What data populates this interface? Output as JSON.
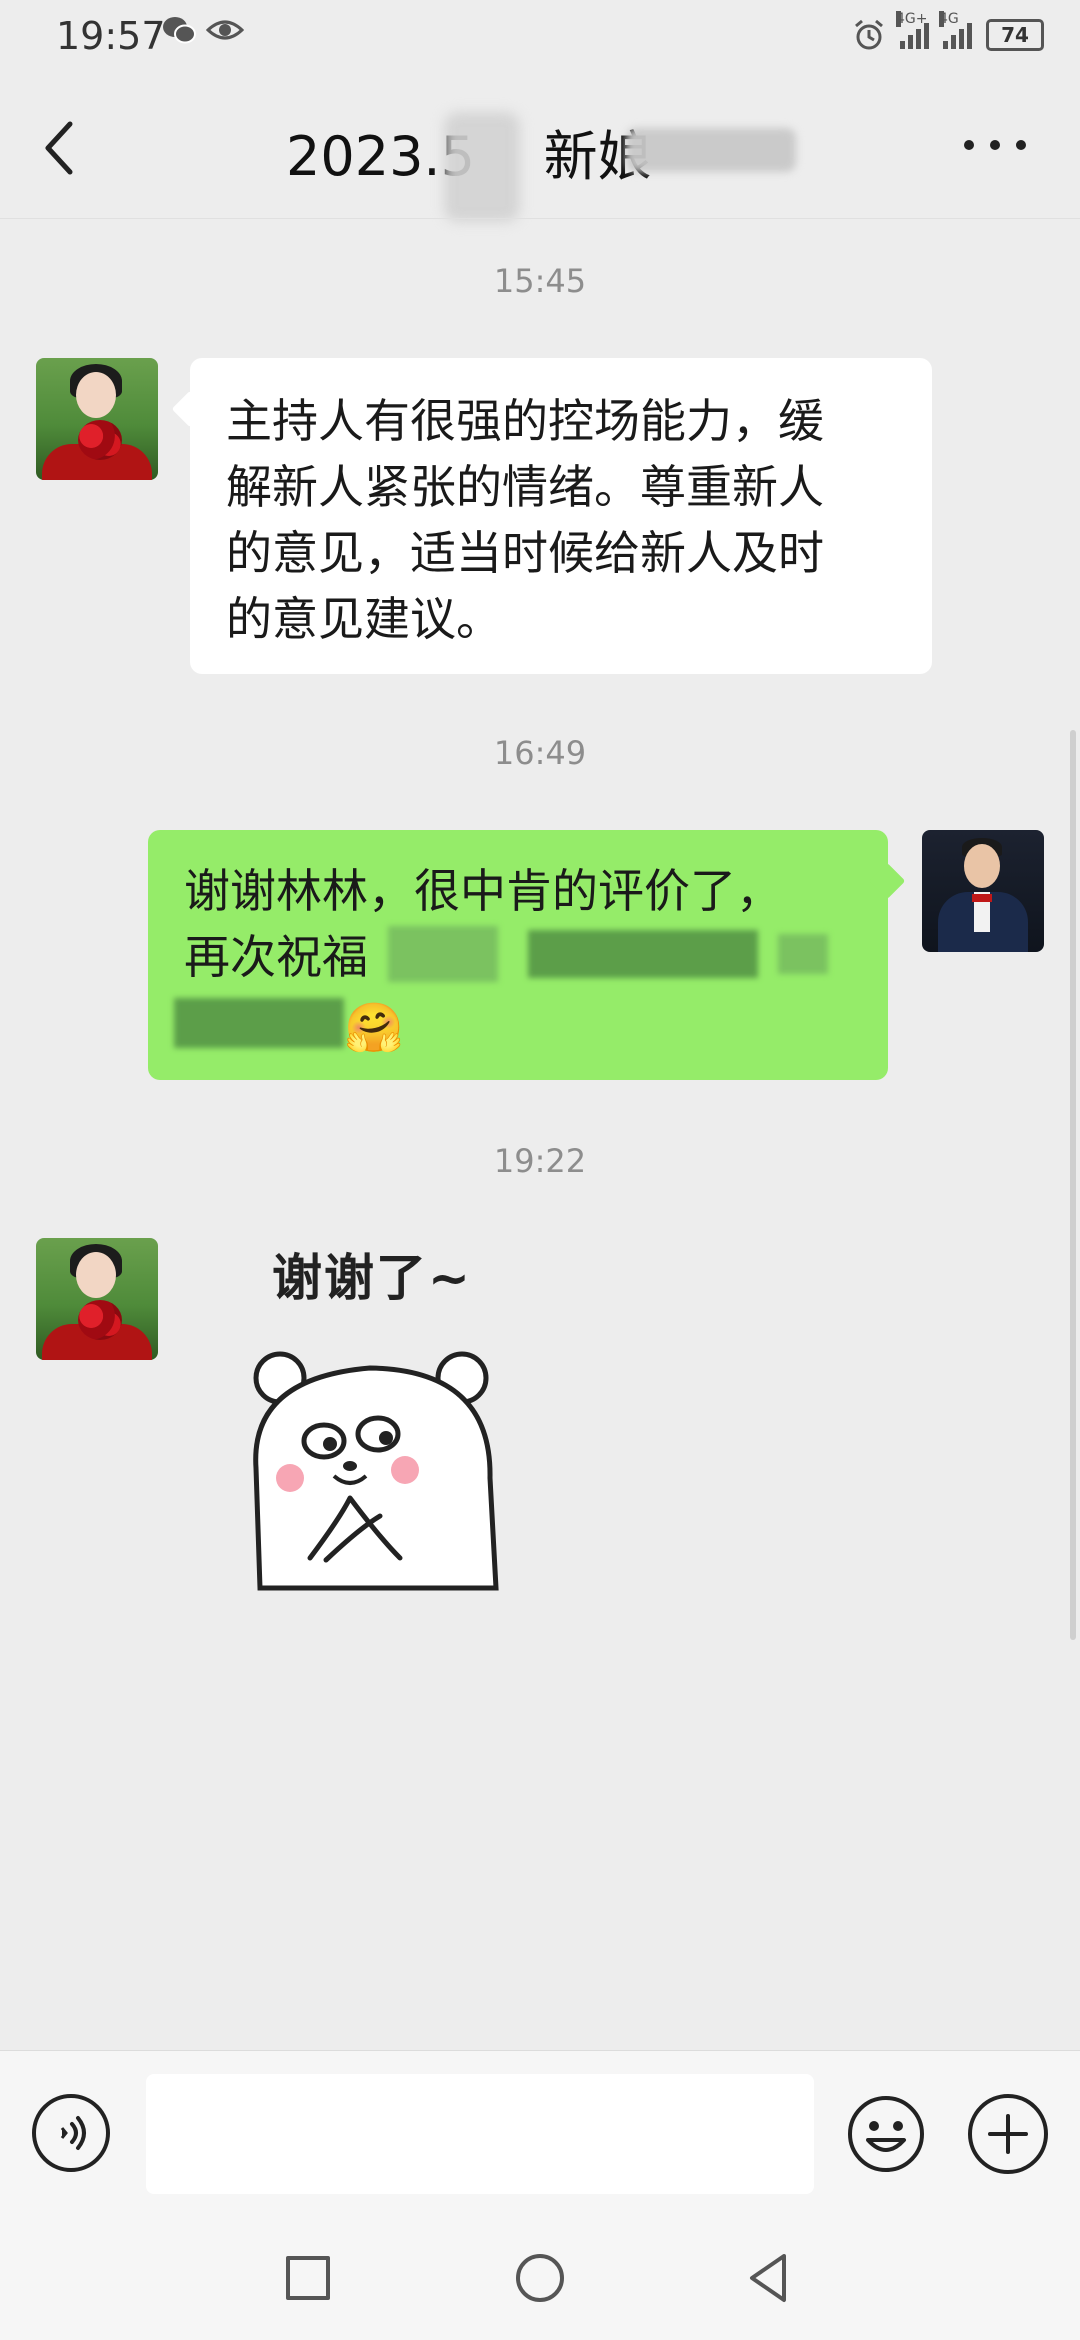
{
  "status_bar": {
    "time": "19:57",
    "left_icons": [
      "wechat-icon",
      "eye-icon"
    ],
    "right_icons": [
      "alarm-icon",
      "signal-4g-plus-icon",
      "signal-4g-icon",
      "battery-icon"
    ],
    "signal_labels": [
      "4G+",
      "4G"
    ],
    "battery": "74"
  },
  "header": {
    "title_visible": "2023.5    新娘",
    "back_icon": "chevron-left-icon",
    "more_icon": "more-dots-icon"
  },
  "messages": [
    {
      "type": "timestamp",
      "text": "15:45"
    },
    {
      "type": "incoming",
      "avatar": "bride-avatar",
      "text_lines": [
        "主持人有很强的控场能力，缓",
        "解新人紧张的情绪。尊重新人",
        "的意见，适当时候给新人及时",
        "的意见建议。"
      ]
    },
    {
      "type": "timestamp",
      "text": "16:49"
    },
    {
      "type": "outgoing",
      "avatar": "host-avatar",
      "text_lines": [
        "谢谢林林，很中肯的评价了，",
        "再次祝福"
      ],
      "emoji": "🤗"
    },
    {
      "type": "timestamp",
      "text": "19:22"
    },
    {
      "type": "incoming-sticker",
      "avatar": "bride-avatar",
      "sticker_text": "谢谢了~",
      "sticker": "bear-sticker"
    }
  ],
  "input_bar": {
    "voice_icon": "voice-icon",
    "input_value": "",
    "emoji_icon": "emoji-icon",
    "plus_icon": "plus-icon"
  },
  "nav_bar": {
    "icons": [
      "recent-apps-icon",
      "home-icon",
      "back-icon"
    ]
  },
  "colors": {
    "background": "#ededed",
    "outgoing_bubble": "#95ec69",
    "incoming_bubble": "#ffffff",
    "timestamp": "#8d8d8d"
  }
}
